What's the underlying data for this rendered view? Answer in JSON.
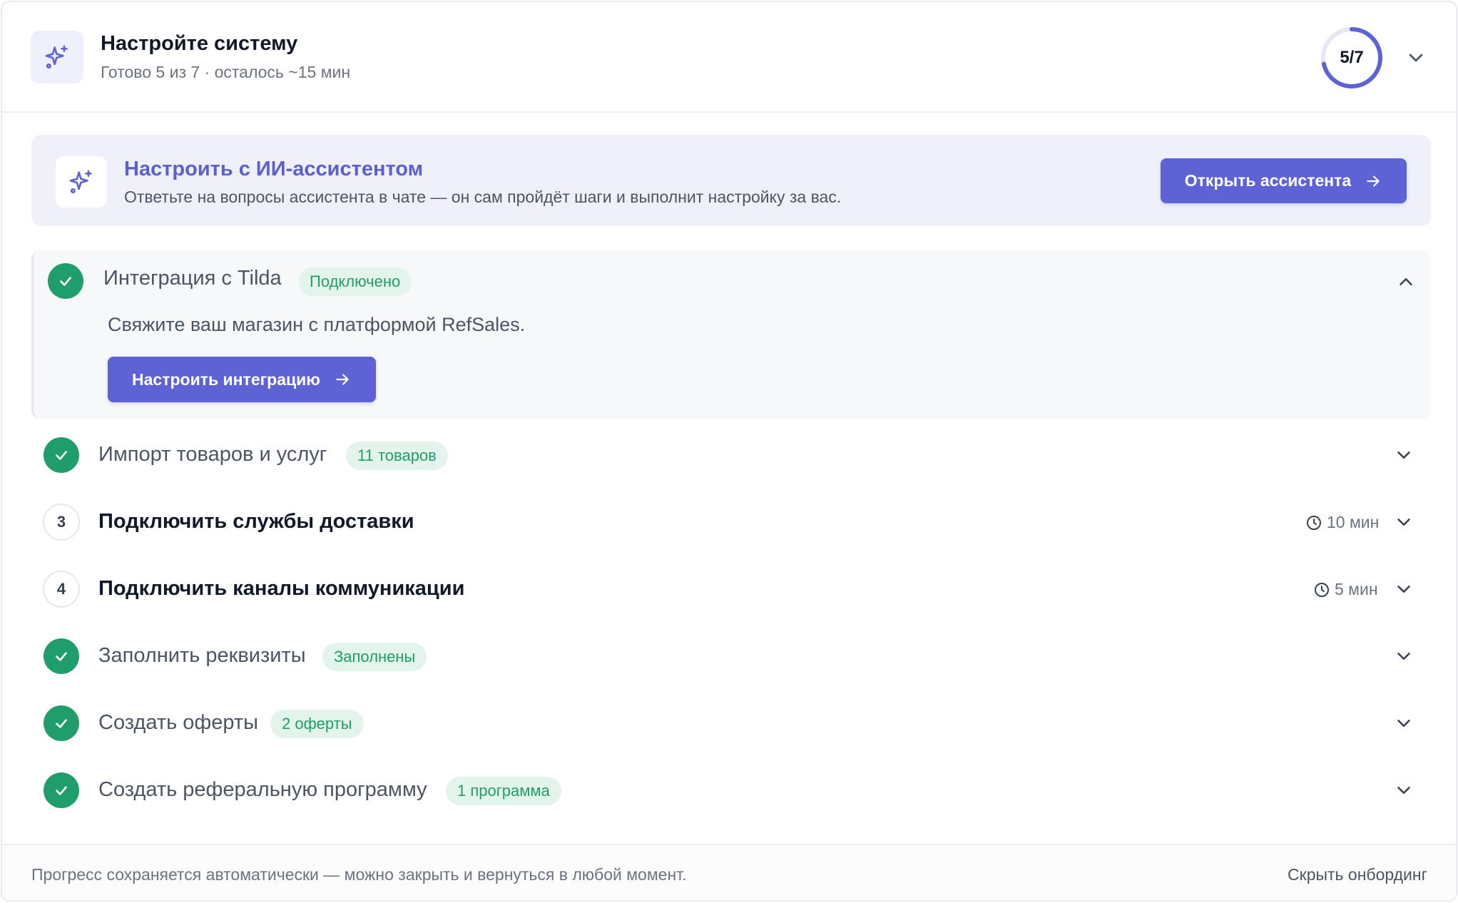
{
  "header": {
    "title": "Настройте систему",
    "subtitle": "Готово 5 из 7 · осталось ~15 мин",
    "progress_text": "5/7",
    "progress_done": 5,
    "progress_total": 7,
    "icon": "sparkles-icon"
  },
  "ai_banner": {
    "title": "Настроить с ИИ-ассистентом",
    "description": "Ответьте на вопросы ассистента в чате — он сам пройдёт шаги и выполнит настройку за вас.",
    "button_label": "Открыть ассистента",
    "icon": "sparkles-icon"
  },
  "steps": [
    {
      "status": "done",
      "label": "Интеграция с Tilda",
      "badge": "Подключено",
      "expanded": true,
      "description": "Свяжите ваш магазин с платформой RefSales.",
      "action_label": "Настроить интеграцию"
    },
    {
      "status": "done",
      "label": "Импорт товаров и услуг",
      "badge": "11 товаров"
    },
    {
      "status": "todo",
      "number": "3",
      "label": "Подключить службы доставки",
      "time": "10 мин"
    },
    {
      "status": "todo",
      "number": "4",
      "label": "Подключить каналы коммуникации",
      "time": "5 мин"
    },
    {
      "status": "done",
      "label": "Заполнить реквизиты",
      "badge": "Заполнены"
    },
    {
      "status": "done",
      "label": "Создать оферты",
      "badge": "2 оферты"
    },
    {
      "status": "done",
      "label": "Создать реферальную программу",
      "badge": "1 программа"
    }
  ],
  "footer": {
    "note": "Прогресс сохраняется автоматически — можно закрыть и вернуться в любой момент.",
    "hide_link": "Скрыть онбординг"
  },
  "colors": {
    "accent": "#5d62d5",
    "success": "#1f9d6a",
    "badge_bg": "#e3f4ec",
    "banner_bg": "#eff0fa"
  }
}
